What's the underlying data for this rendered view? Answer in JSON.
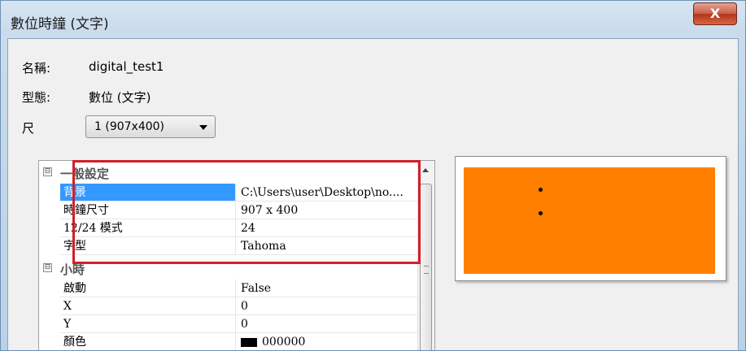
{
  "window": {
    "title": "數位時鐘 (文字)",
    "close_label": "X"
  },
  "fields": [
    {
      "label": "名稱:",
      "value": "digital_test1"
    },
    {
      "label": "型態:",
      "value": "數位 (文字)"
    }
  ],
  "size": {
    "label": "尺",
    "selected": "1  (907x400)"
  },
  "property_grid": {
    "categories": [
      {
        "name": "一般設定",
        "toggle": "⊟",
        "properties": [
          {
            "name": "背景",
            "value": "C:\\Users\\user\\Desktop\\no....",
            "selected": true
          },
          {
            "name": "時鐘尺寸",
            "value": "907 x 400"
          },
          {
            "name": "12/24 模式",
            "value": "24"
          },
          {
            "name": "字型",
            "value": "Tahoma"
          }
        ]
      },
      {
        "name": "小時",
        "toggle": "⊟",
        "properties": [
          {
            "name": "啟動",
            "value": "False"
          },
          {
            "name": "X",
            "value": "0"
          },
          {
            "name": "Y",
            "value": "0"
          },
          {
            "name": "顏色",
            "value": "000000"
          }
        ]
      }
    ]
  },
  "preview": {
    "background_color": "#ff8000"
  }
}
